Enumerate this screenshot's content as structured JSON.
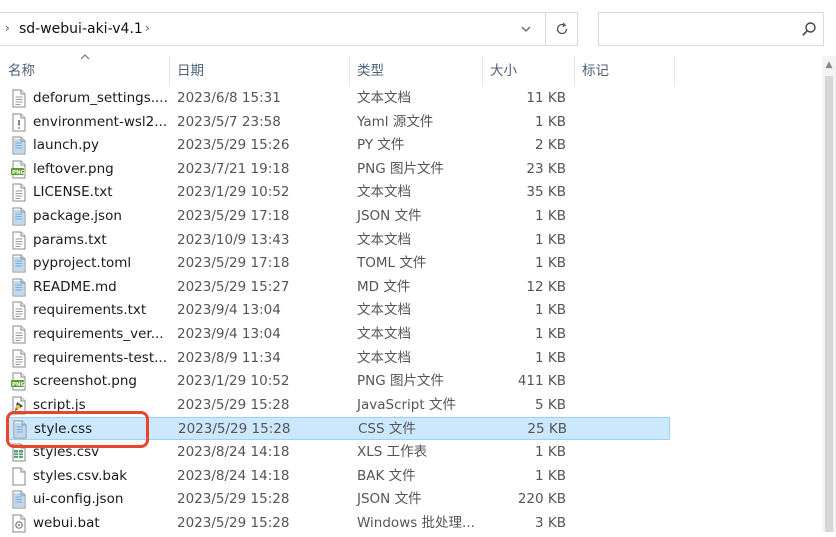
{
  "address_bar": {
    "path_label": "sd-webui-aki-v4.1"
  },
  "search": {
    "placeholder": ""
  },
  "columns": {
    "name": "名称",
    "date": "日期",
    "type": "类型",
    "size": "大小",
    "tags": "标记"
  },
  "files": [
    {
      "name": "deforum_settings....",
      "date": "2023/6/8 15:31",
      "type": "文本文档",
      "size": "11 KB",
      "icon": "text-file-icon"
    },
    {
      "name": "environment-wsl2....",
      "date": "2023/5/7 23:58",
      "type": "Yaml 源文件",
      "size": "1 KB",
      "icon": "yaml-file-icon"
    },
    {
      "name": "launch.py",
      "date": "2023/5/29 15:26",
      "type": "PY 文件",
      "size": "2 KB",
      "icon": "py-file-icon"
    },
    {
      "name": "leftover.png",
      "date": "2023/7/21 19:18",
      "type": "PNG 图片文件",
      "size": "23 KB",
      "icon": "png-file-icon"
    },
    {
      "name": "LICENSE.txt",
      "date": "2023/1/29 10:52",
      "type": "文本文档",
      "size": "35 KB",
      "icon": "text-file-icon"
    },
    {
      "name": "package.json",
      "date": "2023/5/29 17:18",
      "type": "JSON 文件",
      "size": "1 KB",
      "icon": "json-file-icon"
    },
    {
      "name": "params.txt",
      "date": "2023/10/9 13:43",
      "type": "文本文档",
      "size": "1 KB",
      "icon": "text-file-icon"
    },
    {
      "name": "pyproject.toml",
      "date": "2023/5/29 17:18",
      "type": "TOML 文件",
      "size": "1 KB",
      "icon": "toml-file-icon"
    },
    {
      "name": "README.md",
      "date": "2023/5/29 15:27",
      "type": "MD 文件",
      "size": "12 KB",
      "icon": "md-file-icon"
    },
    {
      "name": "requirements.txt",
      "date": "2023/9/4 13:04",
      "type": "文本文档",
      "size": "1 KB",
      "icon": "text-file-icon"
    },
    {
      "name": "requirements_ver...",
      "date": "2023/9/4 13:04",
      "type": "文本文档",
      "size": "1 KB",
      "icon": "text-file-icon"
    },
    {
      "name": "requirements-test...",
      "date": "2023/8/9 11:34",
      "type": "文本文档",
      "size": "1 KB",
      "icon": "text-file-icon"
    },
    {
      "name": "screenshot.png",
      "date": "2023/1/29 10:52",
      "type": "PNG 图片文件",
      "size": "411 KB",
      "icon": "png-file-icon"
    },
    {
      "name": "script.js",
      "date": "2023/5/29 15:28",
      "type": "JavaScript 文件",
      "size": "5 KB",
      "icon": "js-file-icon"
    },
    {
      "name": "style.css",
      "date": "2023/5/29 15:28",
      "type": "CSS 文件",
      "size": "25 KB",
      "icon": "css-file-icon",
      "selected": true
    },
    {
      "name": "styles.csv",
      "date": "2023/8/24 14:18",
      "type": "XLS 工作表",
      "size": "1 KB",
      "icon": "csv-file-icon"
    },
    {
      "name": "styles.csv.bak",
      "date": "2023/8/24 14:18",
      "type": "BAK 文件",
      "size": "1 KB",
      "icon": "blank-file-icon"
    },
    {
      "name": "ui-config.json",
      "date": "2023/5/29 15:28",
      "type": "JSON 文件",
      "size": "220 KB",
      "icon": "json-file-icon"
    },
    {
      "name": "webui.bat",
      "date": "2023/5/29 15:28",
      "type": "Windows 批处理...",
      "size": "3 KB",
      "icon": "bat-file-icon"
    }
  ],
  "colors": {
    "selection_fill": "#cce8ff",
    "selection_border": "#99d1ff",
    "highlight_ring": "#e8452c",
    "header_text": "#4c607a"
  }
}
